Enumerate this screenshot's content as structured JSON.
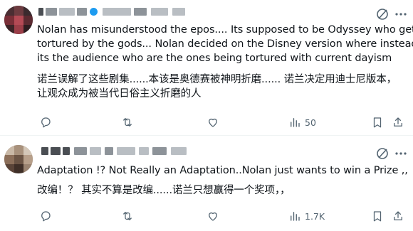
{
  "tweets": [
    {
      "author_name": "",
      "lines": [
        "Nolan has misunderstood the epos.... Its supposed to be  Odyssey who gets",
        "tortured by the gods...  Nolan decided on the Disney version where instead",
        "its the audience who are the ones being tortured with current dayism",
        "诺兰误解了这些剧集......本该是奥德赛被神明折磨...... 诺兰决定用迪士尼版本，",
        "让观众成为被当代日俗主义折磨的人"
      ],
      "actions": {
        "reply_icon": "reply-icon",
        "repost_icon": "repost-icon",
        "like_icon": "heart-icon",
        "views_icon": "views-icon",
        "views_count": "50",
        "bookmark_icon": "bookmark-icon",
        "share_icon": "share-icon"
      },
      "grok_icon": "grok-icon",
      "more_icon": "more-icon"
    },
    {
      "author_name": "",
      "lines": [
        "Adaptation !? Not Really an Adaptation..Nolan just wants to win a Prize ,,",
        "改编！？ 其实不算是改编......诺兰只想赢得一个奖项，，"
      ],
      "actions": {
        "reply_icon": "reply-icon",
        "repost_icon": "repost-icon",
        "like_icon": "heart-icon",
        "views_icon": "views-icon",
        "views_count": "1.7K",
        "bookmark_icon": "bookmark-icon",
        "share_icon": "share-icon"
      },
      "grok_icon": "grok-icon",
      "more_icon": "more-icon"
    }
  ],
  "colors": {
    "text": "#0f1419",
    "secondary": "#536471",
    "divider": "#eff3f4",
    "verified_blue": "#1d9bf0"
  }
}
